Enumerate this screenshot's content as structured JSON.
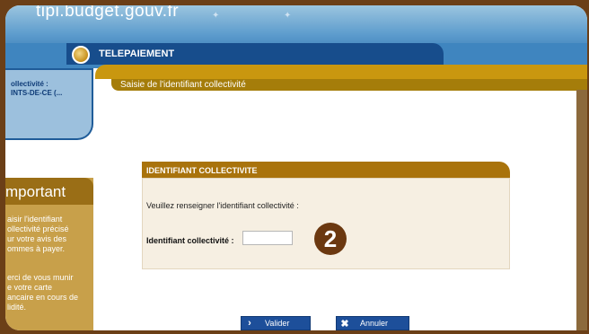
{
  "header": {
    "site_url": "tipi.budget.gouv.fr"
  },
  "section": {
    "title": "TELEPAIEMENT",
    "breadcrumb": "Saisie de l'identifiant collectivité"
  },
  "collectivite": {
    "label": "ollectivité :",
    "value": "INTS-DE-CE (..."
  },
  "important": {
    "title": "mportant",
    "text1": "aisir l'identifiant\nollectivité précisé\nur votre avis des\nommes à payer.",
    "text2": "erci de vous munir\ne votre carte\nancaire en cours de\nlidité."
  },
  "form": {
    "title": "IDENTIFIANT COLLECTIVITE",
    "instruction": "Veuillez renseigner l'identifiant collectivité :",
    "field_label": "Identifiant collectivité :",
    "field_value": "",
    "step_number": "2"
  },
  "buttons": {
    "valider": "Valider",
    "annuler": "Annuler"
  },
  "colors": {
    "blue": "#174d8c",
    "gold": "#c9970f",
    "brown": "#6b3810"
  }
}
